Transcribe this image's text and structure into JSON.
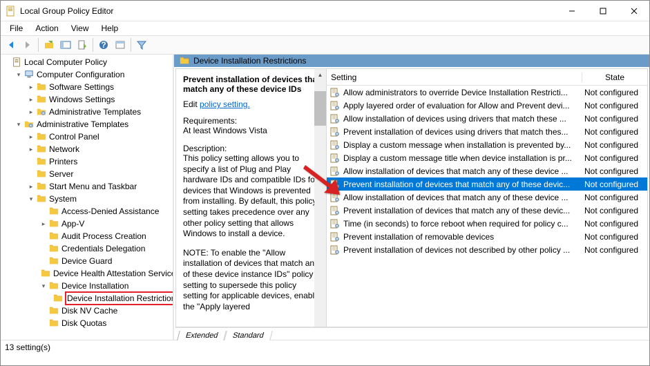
{
  "window": {
    "title": "Local Group Policy Editor"
  },
  "menu": {
    "file": "File",
    "action": "Action",
    "view": "View",
    "help": "Help"
  },
  "tree": {
    "root": "Local Computer Policy",
    "computerConfig": "Computer Configuration",
    "softwareSettings": "Software Settings",
    "windowsSettings": "Windows Settings",
    "adminTemplates1": "Administrative Templates",
    "adminTemplates2": "Administrative Templates",
    "controlPanel": "Control Panel",
    "network": "Network",
    "printers": "Printers",
    "server": "Server",
    "startMenu": "Start Menu and Taskbar",
    "system": "System",
    "accessDenied": "Access-Denied Assistance",
    "appV": "App-V",
    "auditProcess": "Audit Process Creation",
    "credDeleg": "Credentials Delegation",
    "deviceGuard": "Device Guard",
    "deviceHealth": "Device Health Attestation Service",
    "deviceInstall": "Device Installation",
    "deviceInstallRestrict": "Device Installation Restrictions",
    "diskNVCache": "Disk NV Cache",
    "diskQuotas": "Disk Quotas"
  },
  "breadcrumb": "Device Installation Restrictions",
  "desc": {
    "title": "Prevent installation of devices that match any of these device IDs",
    "editPrefix": "Edit ",
    "editLink": "policy setting.",
    "reqLabel": "Requirements:",
    "reqText": "At least Windows Vista",
    "descLabel": "Description:",
    "descText": "This policy setting allows you to specify a list of Plug and Play hardware IDs and compatible IDs for devices that Windows is prevented from installing. By default, this policy setting takes precedence over any other policy setting that allows Windows to install a device.",
    "descText2": "NOTE: To enable the \"Allow installation of devices that match any of these device instance IDs\" policy setting to supersede this policy setting for applicable devices, enable the \"Apply layered"
  },
  "columns": {
    "setting": "Setting",
    "state": "State"
  },
  "settings": [
    {
      "label": "Allow administrators to override Device Installation Restricti...",
      "state": "Not configured"
    },
    {
      "label": "Apply layered order of evaluation for Allow and Prevent devi...",
      "state": "Not configured"
    },
    {
      "label": "Allow installation of devices using drivers that match these ...",
      "state": "Not configured"
    },
    {
      "label": "Prevent installation of devices using drivers that match thes...",
      "state": "Not configured"
    },
    {
      "label": "Display a custom message when installation is prevented by...",
      "state": "Not configured"
    },
    {
      "label": "Display a custom message title when device installation is pr...",
      "state": "Not configured"
    },
    {
      "label": "Allow installation of devices that match any of these device ...",
      "state": "Not configured"
    },
    {
      "label": "Prevent installation of devices that match any of these devic...",
      "state": "Not configured",
      "selected": true
    },
    {
      "label": "Allow installation of devices that match any of these device ...",
      "state": "Not configured"
    },
    {
      "label": "Prevent installation of devices that match any of these devic...",
      "state": "Not configured"
    },
    {
      "label": "Time (in seconds) to force reboot when required for policy c...",
      "state": "Not configured"
    },
    {
      "label": "Prevent installation of removable devices",
      "state": "Not configured"
    },
    {
      "label": "Prevent installation of devices not described by other policy ...",
      "state": "Not configured"
    }
  ],
  "tabs": {
    "extended": "Extended",
    "standard": "Standard"
  },
  "status": "13 setting(s)"
}
